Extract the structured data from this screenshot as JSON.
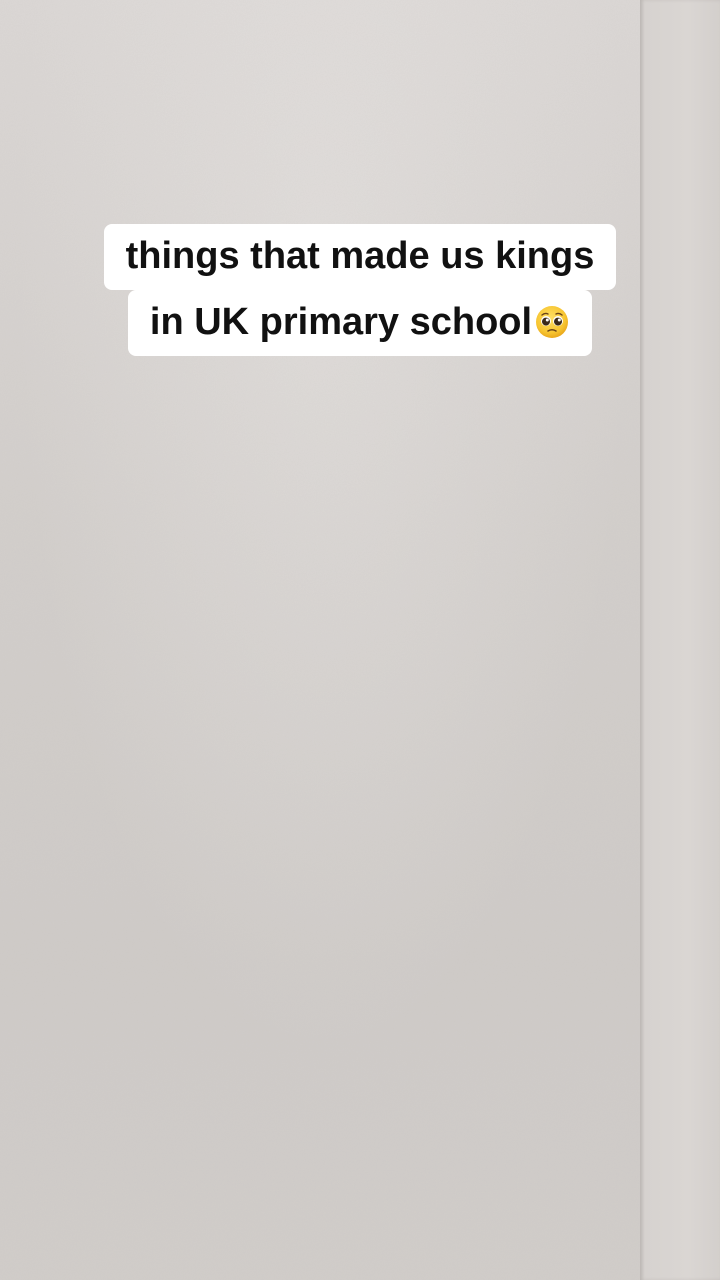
{
  "scene": {
    "description_icon": "pleading-face-icon",
    "wall_color": "#d4d0cd",
    "caption_background": "#ffffff",
    "caption_text_color": "#111111"
  },
  "caption": {
    "line1": "things that made us kings",
    "line2": "in UK primary school"
  }
}
